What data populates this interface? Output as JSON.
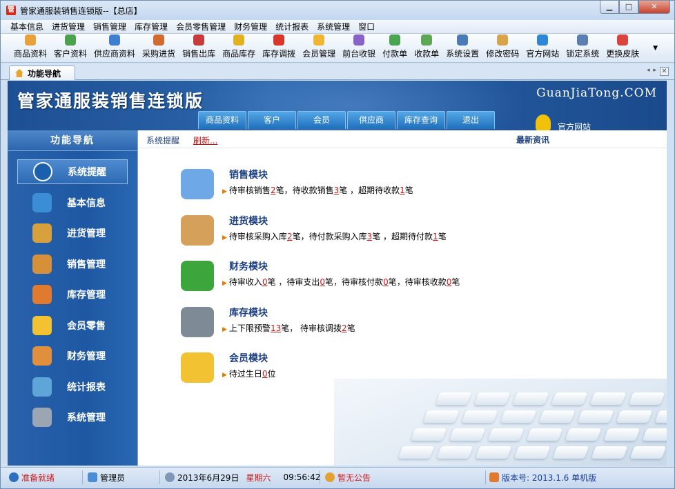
{
  "window": {
    "title": "管家通服装销售连锁版--【总店】",
    "app_icon": "管",
    "controls": {
      "minimize": "▁",
      "maximize": "□",
      "close": "✕"
    }
  },
  "menu": [
    "基本信息",
    "进货管理",
    "销售管理",
    "库存管理",
    "会员零售管理",
    "财务管理",
    "统计报表",
    "系统管理",
    "窗口"
  ],
  "toolbar": [
    {
      "label": "商品资料",
      "icon": "goods-icon",
      "color": "#e8a23a"
    },
    {
      "label": "客户资料",
      "icon": "customer-icon",
      "color": "#4aa34a"
    },
    {
      "label": "供应商资料",
      "icon": "supplier-icon",
      "color": "#3f7fd0"
    },
    {
      "label": "采购进货",
      "icon": "purchase-icon",
      "color": "#d36a2e"
    },
    {
      "label": "销售出库",
      "icon": "sales-icon",
      "color": "#c73b3b"
    },
    {
      "label": "商品库存",
      "icon": "stock-icon",
      "color": "#e2b11f"
    },
    {
      "label": "库存调拨",
      "icon": "transfer-icon",
      "color": "#d9372a"
    },
    {
      "label": "会员管理",
      "icon": "member-icon",
      "color": "#f0b632"
    },
    {
      "label": "前台收银",
      "icon": "cashier-icon",
      "color": "#8a63c9"
    },
    {
      "label": "付款单",
      "icon": "payment-icon",
      "color": "#49a551"
    },
    {
      "label": "收款单",
      "icon": "receipt-icon",
      "color": "#5da852"
    },
    {
      "label": "系统设置",
      "icon": "settings-icon",
      "color": "#4a7bb8"
    },
    {
      "label": "修改密码",
      "icon": "password-icon",
      "color": "#d8a34a"
    },
    {
      "label": "官方网站",
      "icon": "ie-icon",
      "color": "#2e86d4"
    },
    {
      "label": "锁定系统",
      "icon": "lock-icon",
      "color": "#5b7fb3"
    },
    {
      "label": "更换皮肤",
      "icon": "skin-icon",
      "color": "#d9453c"
    }
  ],
  "toolbar_more": "▼",
  "tabs": {
    "active": "功能导航",
    "prev": "◂",
    "next": "▸",
    "close": "✕"
  },
  "banner": {
    "brand": "管家通服装销售连锁版",
    "site": "GuanJiaTong.COM",
    "nav": [
      "商品资料",
      "客户",
      "会员",
      "供应商",
      "库存查询",
      "退出"
    ],
    "official": "官方网站"
  },
  "leftnav": {
    "title": "功能导航",
    "items": [
      {
        "label": "系统提醒",
        "icon": "info-icon",
        "color": "#1b5fae"
      },
      {
        "label": "基本信息",
        "icon": "cubes-icon",
        "color": "#3b8ed6"
      },
      {
        "label": "进货管理",
        "icon": "box-in-icon",
        "color": "#d7a03c"
      },
      {
        "label": "销售管理",
        "icon": "box-out-icon",
        "color": "#d7903a"
      },
      {
        "label": "库存管理",
        "icon": "warehouse-icon",
        "color": "#e07a2e"
      },
      {
        "label": "会员零售",
        "icon": "chat-icon",
        "color": "#f2c233"
      },
      {
        "label": "财务管理",
        "icon": "finance-icon",
        "color": "#e08f3c"
      },
      {
        "label": "统计报表",
        "icon": "chart-icon",
        "color": "#5ea6d8"
      },
      {
        "label": "系统管理",
        "icon": "gears-icon",
        "color": "#9ba6b2"
      }
    ]
  },
  "content": {
    "header_title": "系统提醒",
    "refresh": "刷新...",
    "news": "最新资讯",
    "arrow": "▶",
    "modules": [
      {
        "name": "销售模块",
        "icon": "book-icon",
        "color": "#6fa8e6",
        "parts": [
          "待审核销售",
          "2",
          "笔，待收款销售",
          "3",
          "笔 ，超期待收款",
          "1",
          "笔"
        ]
      },
      {
        "name": "进货模块",
        "icon": "package-icon",
        "color": "#d4a05a",
        "parts": [
          "待审核采购入库",
          "2",
          "笔，待付款采购入库",
          "3",
          "笔 ，超期待付款",
          "1",
          "笔"
        ]
      },
      {
        "name": "财务模块",
        "icon": "dollar-icon",
        "color": "#3ca53c",
        "parts": [
          "待审收入",
          "0",
          "笔 ，待审支出",
          "0",
          "笔，待审核付款",
          "0",
          "笔，待审核收款",
          "0",
          "笔"
        ]
      },
      {
        "name": "库存模块",
        "icon": "database-icon",
        "color": "#7e8a96",
        "parts": [
          "上下限预警",
          "13",
          "笔， 待审核调拨",
          "2",
          "笔"
        ]
      },
      {
        "name": "会员模块",
        "icon": "chat-bubbles-icon",
        "color": "#f2c233",
        "parts": [
          "待过生日",
          "0",
          "位"
        ]
      }
    ]
  },
  "statusbar": {
    "ready": "准备就绪",
    "user": "管理员",
    "date": "2013年6月29日",
    "weekday": "星期六",
    "time": "09:56:42",
    "notice": "暂无公告",
    "version": "版本号: 2013.1.6 单机版",
    "colors": {
      "alert": "#d01818",
      "version": "#1a3d9a"
    }
  }
}
